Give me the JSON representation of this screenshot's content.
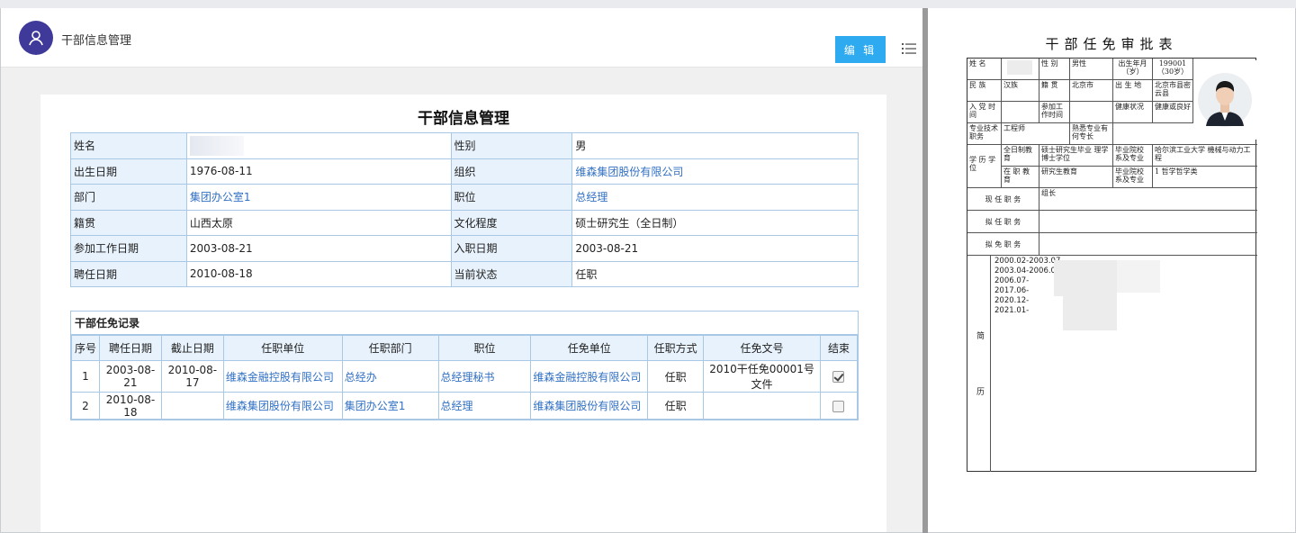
{
  "app": {
    "title": "干部信息管理",
    "edit_label": "编 辑"
  },
  "card": {
    "title": "干部信息管理"
  },
  "info": {
    "rows": [
      {
        "l1": "姓名",
        "v1": "",
        "l2": "性别",
        "v2": "男"
      },
      {
        "l1": "出生日期",
        "v1": "1976-08-11",
        "l2": "组织",
        "v2": "维森集团股份有限公司"
      },
      {
        "l1": "部门",
        "v1": "集团办公室1",
        "l2": "职位",
        "v2": "总经理"
      },
      {
        "l1": "籍贯",
        "v1": "山西太原",
        "l2": "文化程度",
        "v2": "硕士研究生（全日制）"
      },
      {
        "l1": "参加工作日期",
        "v1": "2003-08-21",
        "l2": "入职日期",
        "v2": "2003-08-21"
      },
      {
        "l1": "聘任日期",
        "v1": "2010-08-18",
        "l2": "当前状态",
        "v2": "任职"
      }
    ]
  },
  "records": {
    "title": "干部任免记录",
    "columns": [
      "序号",
      "聘任日期",
      "截止日期",
      "任职单位",
      "任职部门",
      "职位",
      "任免单位",
      "任职方式",
      "任免文号",
      "结束"
    ],
    "rows": [
      {
        "no": "1",
        "start": "2003-08-21",
        "end": "2010-08-17",
        "unit": "维森金融控股有限公司",
        "dept": "总经办",
        "post": "总经理秘书",
        "appoint_unit": "维森金融控股有限公司",
        "method": "任职",
        "doc_no": "2010干任免00001号文件",
        "ended": true
      },
      {
        "no": "2",
        "start": "2010-08-18",
        "end": "",
        "unit": "维森集团股份有限公司",
        "dept": "集团办公室1",
        "post": "总经理",
        "appoint_unit": "维森集团股份有限公司",
        "method": "任职",
        "doc_no": "",
        "ended": false
      }
    ]
  },
  "approval_form": {
    "title": "干部任免审批表",
    "name_label": "姓 名",
    "gender_label": "性 别",
    "gender_value": "男性",
    "birth_label": "出生年月（岁）",
    "birth_value": "199001（30岁）",
    "ethnic_label": "民 族",
    "ethnic_value": "汉族",
    "native_label": "籍 贯",
    "native_value": "北京市",
    "birthplace_label": "出 生 地",
    "birthplace_value": "北京市县密云县",
    "party_label": "入 党 时 间",
    "work_label": "参加工作时间",
    "health_label": "健康状况",
    "health_value": "健康或良好",
    "title_label": "专业技术职务",
    "title_value": "工程师",
    "skill_label": "熟悉专业有何专长",
    "edu_label": "学 历 学 位",
    "fulltime_label": "全日制教育",
    "fulltime_value": "硕士研究生毕业 理学博士学位",
    "school_label": "毕业院校系及专业",
    "school_value": "哈尔滨工业大学 機械与动力工程",
    "parttime_label": "在 职 教 育",
    "parttime_value": "研究生教育",
    "school2_label": "毕业院校系及专业",
    "school2_value": "1 哲学哲学类",
    "current_label": "现 任 职 务",
    "current_value": "组长",
    "proposed_label": "拟 任 职 务",
    "remove_label": "拟 免 职 务",
    "resume_label_1": "简",
    "resume_label_2": "历",
    "resume_lines": [
      "2000.02-2003.07",
      "2003.04-2006.06",
      "2006.07-",
      "2017.06-",
      "2020.12-",
      "2021.01-"
    ]
  }
}
